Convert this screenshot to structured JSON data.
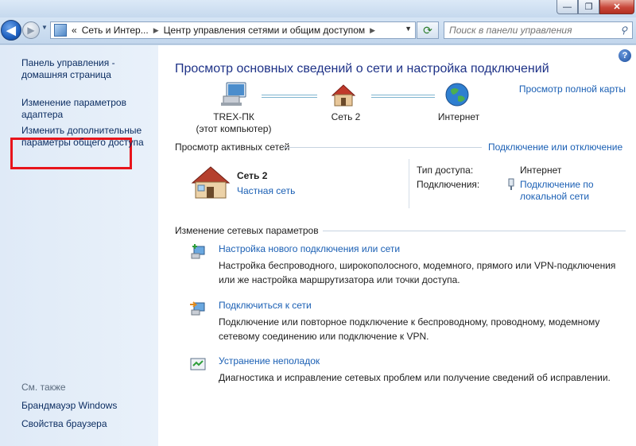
{
  "window": {
    "minimize": "—",
    "maximize": "❐",
    "close": "✕"
  },
  "nav": {
    "back": "◀",
    "forward": "▶",
    "breadcrumb": [
      "«",
      "Сеть и Интер...",
      "Центр управления сетями и общим доступом"
    ],
    "search_placeholder": "Поиск в панели управления"
  },
  "sidebar": {
    "items": [
      {
        "label": "Панель управления - домашняя страница"
      },
      {
        "label": "Изменение параметров адаптера"
      },
      {
        "label": "Изменить дополнительные параметры общего доступа"
      }
    ],
    "see_also_title": "См. также",
    "see_also": [
      "Брандмауэр Windows",
      "Свойства браузера"
    ]
  },
  "main": {
    "title": "Просмотр основных сведений о сети и настройка подключений",
    "full_map_link": "Просмотр полной карты",
    "map_nodes": [
      {
        "label": "TREX-ПК",
        "sublabel": "(этот компьютер)"
      },
      {
        "label": "Сеть  2"
      },
      {
        "label": "Интернет"
      }
    ],
    "active_networks_title": "Просмотр активных сетей",
    "connect_disconnect_link": "Подключение или отключение",
    "network": {
      "name": "Сеть  2",
      "type_link": "Частная сеть",
      "access_type_label": "Тип доступа:",
      "access_type_value": "Интернет",
      "connections_label": "Подключения:",
      "connections_value": "Подключение по локальной сети"
    },
    "change_settings_title": "Изменение сетевых параметров",
    "tasks": [
      {
        "title": "Настройка нового подключения или сети",
        "desc": "Настройка беспроводного, широкополосного, модемного, прямого или VPN-подключения или же настройка маршрутизатора или точки доступа."
      },
      {
        "title": "Подключиться к сети",
        "desc": "Подключение или повторное подключение к беспроводному, проводному, модемному сетевому соединению или подключение к VPN."
      },
      {
        "title": "Устранение неполадок",
        "desc": "Диагностика и исправление сетевых проблем или получение сведений об исправлении."
      }
    ]
  }
}
